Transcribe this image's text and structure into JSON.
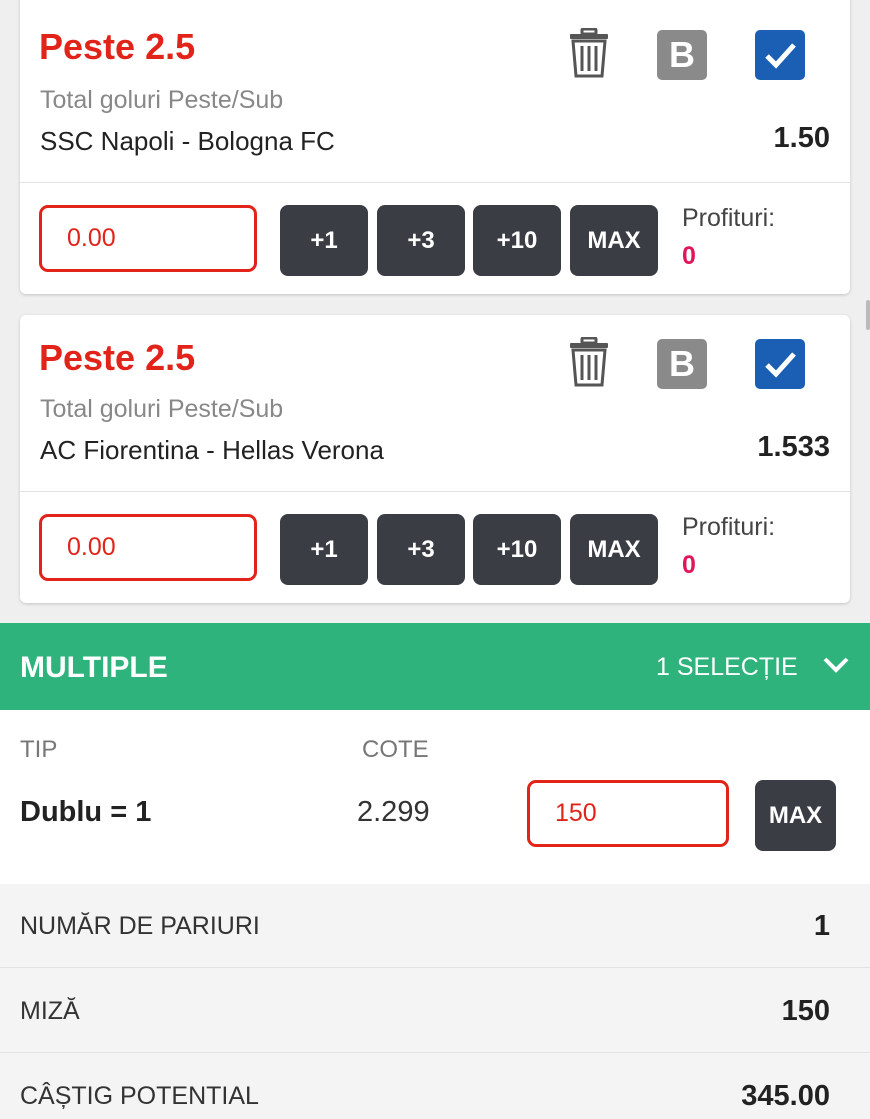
{
  "selections": [
    {
      "title": "Peste 2.5",
      "market": "Total goluri Peste/Sub",
      "event": "SSC Napoli - Bologna FC",
      "odds": "1.50",
      "stake_value": "0.00",
      "quick_buttons": [
        "+1",
        "+3",
        "+10",
        "MAX"
      ],
      "profit_label": "Profituri:",
      "profit_value": "0",
      "icons": [
        "trash-icon",
        "banker-b-icon",
        "checkbox-checked-icon"
      ]
    },
    {
      "title": "Peste 2.5",
      "market": "Total goluri Peste/Sub",
      "event": "AC Fiorentina - Hellas Verona",
      "odds": "1.533",
      "stake_value": "0.00",
      "quick_buttons": [
        "+1",
        "+3",
        "+10",
        "MAX"
      ],
      "profit_label": "Profituri:",
      "profit_value": "0",
      "icons": [
        "trash-icon",
        "banker-b-icon",
        "checkbox-checked-icon"
      ]
    }
  ],
  "multiple": {
    "title": "MULTIPLE",
    "selection_count": "1 SELECȚIE",
    "col_tip": "TIP",
    "col_cote": "COTE",
    "bet_type": "Dublu = 1",
    "odds": "2.299",
    "stake_value": "150",
    "max_label": "MAX"
  },
  "summary": [
    {
      "label": "NUMĂR DE PARIURI",
      "value": "1"
    },
    {
      "label": "MIZĂ",
      "value": "150"
    },
    {
      "label": "CÂȘTIG POTENTIAL",
      "value": "345.00"
    }
  ],
  "colors": {
    "accent_red": "#e2231a",
    "profit_pink": "#e2145a",
    "green_bar": "#2db37b",
    "dark_button": "#3a3e44",
    "check_blue": "#1a5fb4",
    "banker_grey": "#8a8a8a"
  }
}
